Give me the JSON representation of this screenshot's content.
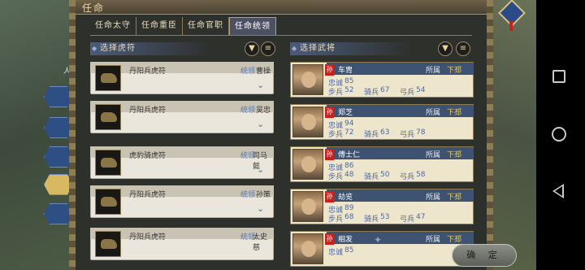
{
  "dialog": {
    "title": "任命",
    "confirm_label": "确 定"
  },
  "tabs": [
    {
      "label": "任命太守",
      "active": false
    },
    {
      "label": "任命重臣",
      "active": false
    },
    {
      "label": "任命官职",
      "active": false
    },
    {
      "label": "任命统领",
      "active": true
    }
  ],
  "left_panel": {
    "title": "选择虎符",
    "filter_icon": "filter-icon",
    "list_icon": "list-icon",
    "tallies": [
      {
        "name": "丹阳兵虎符",
        "owner_label": "统领",
        "owner": "曹操"
      },
      {
        "name": "丹阳兵虎符",
        "owner_label": "统领",
        "owner": "吴忠"
      },
      {
        "name": "虎豹骑虎符",
        "owner_label": "统领",
        "owner": "司马懿"
      },
      {
        "name": "丹阳兵虎符",
        "owner_label": "统领",
        "owner": "孙策"
      },
      {
        "name": "丹阳兵虎符",
        "owner_label": "统领",
        "owner": "太史慈"
      }
    ]
  },
  "right_panel": {
    "title": "选择武将",
    "filter_icon": "filter-icon",
    "list_icon": "list-icon",
    "generals": [
      {
        "faction": "孙",
        "name": "车胄",
        "belong_label": "所属",
        "belong": "下邳",
        "loyalty_label": "忠诚",
        "loyalty": "85",
        "infantry_label": "步兵",
        "infantry": "52",
        "cavalry_label": "骑兵",
        "cavalry": "67",
        "archer_label": "弓兵",
        "archer": "54"
      },
      {
        "faction": "孙",
        "name": "郑芝",
        "belong_label": "所属",
        "belong": "下邳",
        "loyalty_label": "忠诚",
        "loyalty": "94",
        "infantry_label": "步兵",
        "infantry": "72",
        "cavalry_label": "骑兵",
        "cavalry": "63",
        "archer_label": "弓兵",
        "archer": "78"
      },
      {
        "faction": "孙",
        "name": "傅士仁",
        "belong_label": "所属",
        "belong": "下邳",
        "loyalty_label": "忠诚",
        "loyalty": "86",
        "infantry_label": "步兵",
        "infantry": "48",
        "cavalry_label": "骑兵",
        "cavalry": "50",
        "archer_label": "弓兵",
        "archer": "58"
      },
      {
        "faction": "孙",
        "name": "劫览",
        "belong_label": "所属",
        "belong": "下邳",
        "loyalty_label": "忠诚",
        "loyalty": "89",
        "infantry_label": "步兵",
        "infantry": "68",
        "cavalry_label": "骑兵",
        "cavalry": "53",
        "archer_label": "弓兵",
        "archer": "47"
      },
      {
        "faction": "孙",
        "name": "相发",
        "belong_label": "所属",
        "belong": "下邳",
        "loyalty_label": "忠诚",
        "loyalty": "85",
        "infantry_label": "",
        "infantry": "",
        "cavalry_label": "",
        "cavalry": "",
        "archer_label": "",
        "archer": ""
      }
    ]
  },
  "background": {
    "side_label": "人"
  },
  "nav": {
    "square_icon": "recent-apps-icon",
    "circle_icon": "home-icon",
    "back_icon": "back-icon"
  }
}
